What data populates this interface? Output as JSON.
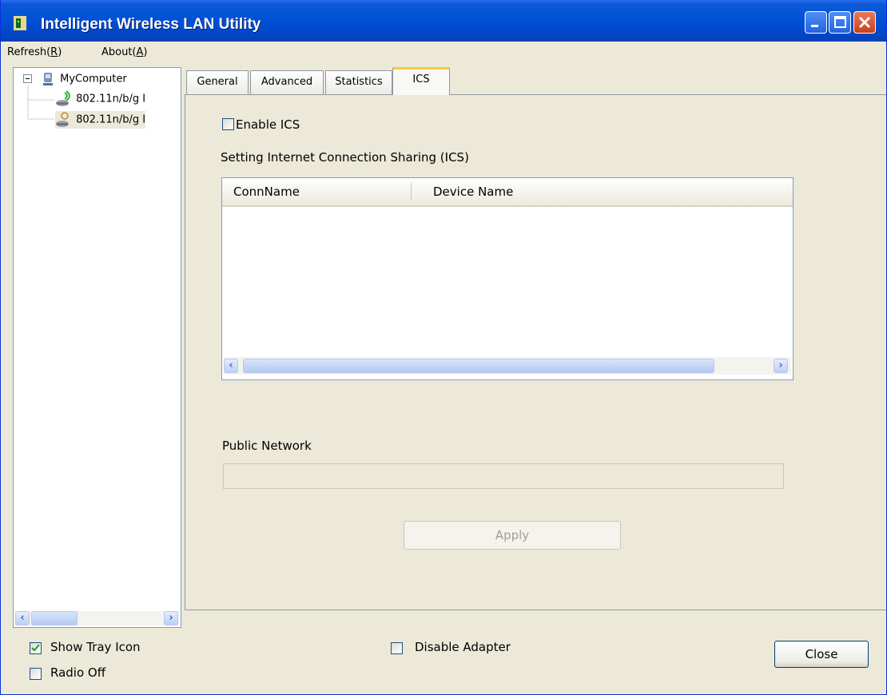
{
  "window": {
    "title": "Intelligent Wireless LAN Utility"
  },
  "menu": {
    "items": [
      {
        "prefix": "Refresh(",
        "key": "R",
        "suffix": ")"
      },
      {
        "prefix": "About(",
        "key": "A",
        "suffix": ")"
      }
    ]
  },
  "tree": {
    "root": "MyComputer",
    "adapters": [
      "802.11n/b/g I",
      "802.11n/b/g I"
    ]
  },
  "tabs": [
    "General",
    "Advanced",
    "Statistics",
    "ICS"
  ],
  "ics": {
    "enable_label": "Enable ICS",
    "section_title": "Setting Internet Connection Sharing (ICS)",
    "columns": [
      "ConnName",
      "Device Name"
    ],
    "public_network_label": "Public Network",
    "public_network_value": "",
    "apply_label": "Apply"
  },
  "bottom": {
    "show_tray_icon": "Show Tray Icon",
    "show_tray_checked": true,
    "radio_off": "Radio Off",
    "disable_adapter": "Disable Adapter",
    "close_label": "Close"
  },
  "colors": {
    "title_bar": "#0050d6",
    "window_bg": "#ece9d8",
    "active_tab_accent": "#ffc83c",
    "checkbox_border": "#1c5180"
  }
}
